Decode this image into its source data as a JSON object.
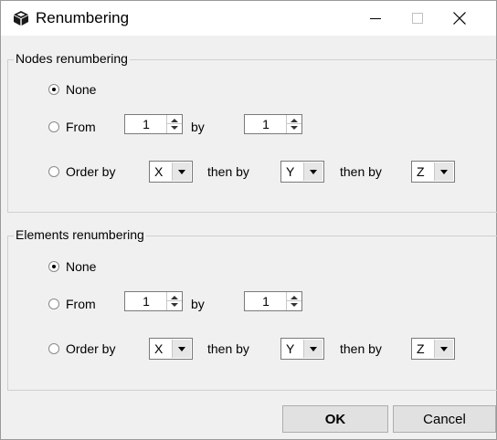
{
  "window": {
    "title": "Renumbering"
  },
  "nodes": {
    "group_label": "Nodes renumbering",
    "none_label": "None",
    "from_label": "From",
    "from_value": "1",
    "by_label": "by",
    "by_value": "1",
    "order_by_label": "Order by",
    "order1": "X",
    "then_by_label_1": "then by",
    "order2": "Y",
    "then_by_label_2": "then by",
    "order3": "Z",
    "selected": "None"
  },
  "elements": {
    "group_label": "Elements renumbering",
    "none_label": "None",
    "from_label": "From",
    "from_value": "1",
    "by_label": "by",
    "by_value": "1",
    "order_by_label": "Order by",
    "order1": "X",
    "then_by_label_1": "then by",
    "order2": "Y",
    "then_by_label_2": "then by",
    "order3": "Z",
    "selected": "None"
  },
  "buttons": {
    "ok": "OK",
    "cancel": "Cancel"
  },
  "icons": {
    "app": "cube-icon",
    "minimize": "minimize-icon",
    "maximize": "maximize-icon",
    "close": "close-icon"
  }
}
